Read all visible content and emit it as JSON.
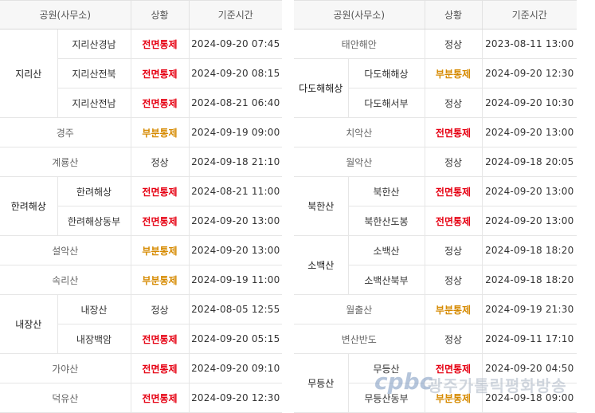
{
  "headers": {
    "park": "공원(사무소)",
    "status": "상황",
    "time": "기준시간"
  },
  "status_colors": {
    "전면통제": "#e60012",
    "부분통제": "#d68a00",
    "정상": "#333333"
  },
  "left_rows": [
    {
      "park": "지리산",
      "office": "지리산경남",
      "status": "전면통제",
      "time": "2024-09-20 07:45"
    },
    {
      "park": "지리산",
      "office": "지리산전북",
      "status": "전면통제",
      "time": "2024-09-20 08:15"
    },
    {
      "park": "지리산",
      "office": "지리산전남",
      "status": "전면통제",
      "time": "2024-08-21 06:40"
    },
    {
      "park": "경주",
      "office": "",
      "status": "부분통제",
      "time": "2024-09-19 09:00"
    },
    {
      "park": "계룡산",
      "office": "",
      "status": "정상",
      "time": "2024-09-18 21:10"
    },
    {
      "park": "한려해상",
      "office": "한려해상",
      "status": "전면통제",
      "time": "2024-08-21 11:00"
    },
    {
      "park": "한려해상",
      "office": "한려해상동부",
      "status": "전면통제",
      "time": "2024-09-20 13:00"
    },
    {
      "park": "설악산",
      "office": "",
      "status": "부분통제",
      "time": "2024-09-20 13:00"
    },
    {
      "park": "속리산",
      "office": "",
      "status": "부분통제",
      "time": "2024-09-19 11:00"
    },
    {
      "park": "내장산",
      "office": "내장산",
      "status": "정상",
      "time": "2024-08-05 12:55"
    },
    {
      "park": "내장산",
      "office": "내장백암",
      "status": "전면통제",
      "time": "2024-09-20 05:15"
    },
    {
      "park": "가야산",
      "office": "",
      "status": "전면통제",
      "time": "2024-09-20 09:10"
    },
    {
      "park": "덕유산",
      "office": "",
      "status": "전면통제",
      "time": "2024-09-20 12:30"
    }
  ],
  "right_rows": [
    {
      "park": "태안해안",
      "office": "",
      "status": "정상",
      "time": "2023-08-11 13:00"
    },
    {
      "park": "다도해해상",
      "office": "다도해해상",
      "status": "부분통제",
      "time": "2024-09-20 12:30"
    },
    {
      "park": "다도해해상",
      "office": "다도해서부",
      "status": "정상",
      "time": "2024-09-20 10:30"
    },
    {
      "park": "치악산",
      "office": "",
      "status": "전면통제",
      "time": "2024-09-20 13:00"
    },
    {
      "park": "월악산",
      "office": "",
      "status": "정상",
      "time": "2024-09-18 20:05"
    },
    {
      "park": "북한산",
      "office": "북한산",
      "status": "전면통제",
      "time": "2024-09-20 13:00"
    },
    {
      "park": "북한산",
      "office": "북한산도봉",
      "status": "전면통제",
      "time": "2024-09-20 13:00"
    },
    {
      "park": "소백산",
      "office": "소백산",
      "status": "정상",
      "time": "2024-09-18 18:20"
    },
    {
      "park": "소백산",
      "office": "소백산북부",
      "status": "정상",
      "time": "2024-09-18 18:20"
    },
    {
      "park": "월출산",
      "office": "",
      "status": "부분통제",
      "time": "2024-09-19 21:30"
    },
    {
      "park": "변산반도",
      "office": "",
      "status": "정상",
      "time": "2024-09-11 17:10"
    },
    {
      "park": "무등산",
      "office": "무등산",
      "status": "전면통제",
      "time": "2024-09-20 04:50"
    },
    {
      "park": "무등산",
      "office": "무등산동부",
      "status": "부분통제",
      "time": "2024-09-18 09:00"
    }
  ],
  "watermark": {
    "logo": "cpbc",
    "text": "광주가톨릭평화방송"
  }
}
